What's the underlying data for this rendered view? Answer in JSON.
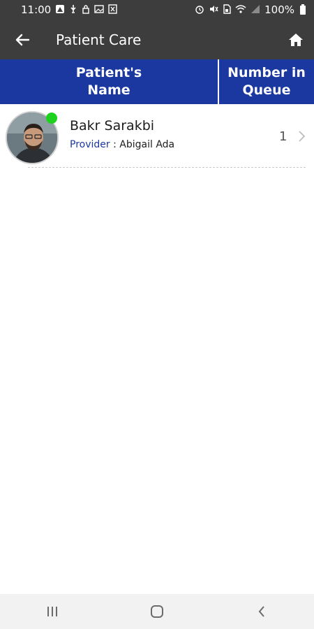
{
  "status_bar": {
    "time": "11:00",
    "battery": "100%",
    "left_icons": [
      "notification-icon",
      "usb-icon",
      "lock-icon",
      "gallery-icon",
      "app-icon"
    ],
    "right_icons": [
      "alarm-icon",
      "mute-icon",
      "sim-icon",
      "wifi-icon",
      "signal-icon",
      "battery-icon"
    ]
  },
  "app_bar": {
    "title": "Patient Care",
    "back_icon": "back-arrow-icon",
    "home_icon": "home-icon"
  },
  "table": {
    "header": {
      "name_col": "Patient's\nName",
      "queue_col": "Number in\nQueue"
    },
    "rows": [
      {
        "name": "Bakr Sarakbi",
        "provider_label": "Provider",
        "provider_separator": " : ",
        "provider_name": "Abigail Ada",
        "queue_number": "1",
        "online": true
      }
    ]
  },
  "colors": {
    "bar_dark": "#3d3d3d",
    "header_blue": "#1a38a0",
    "online_green": "#1ed11e"
  },
  "nav_bar": {
    "buttons": [
      "recent-apps-icon",
      "home-circle-icon",
      "back-chevron-icon"
    ]
  }
}
